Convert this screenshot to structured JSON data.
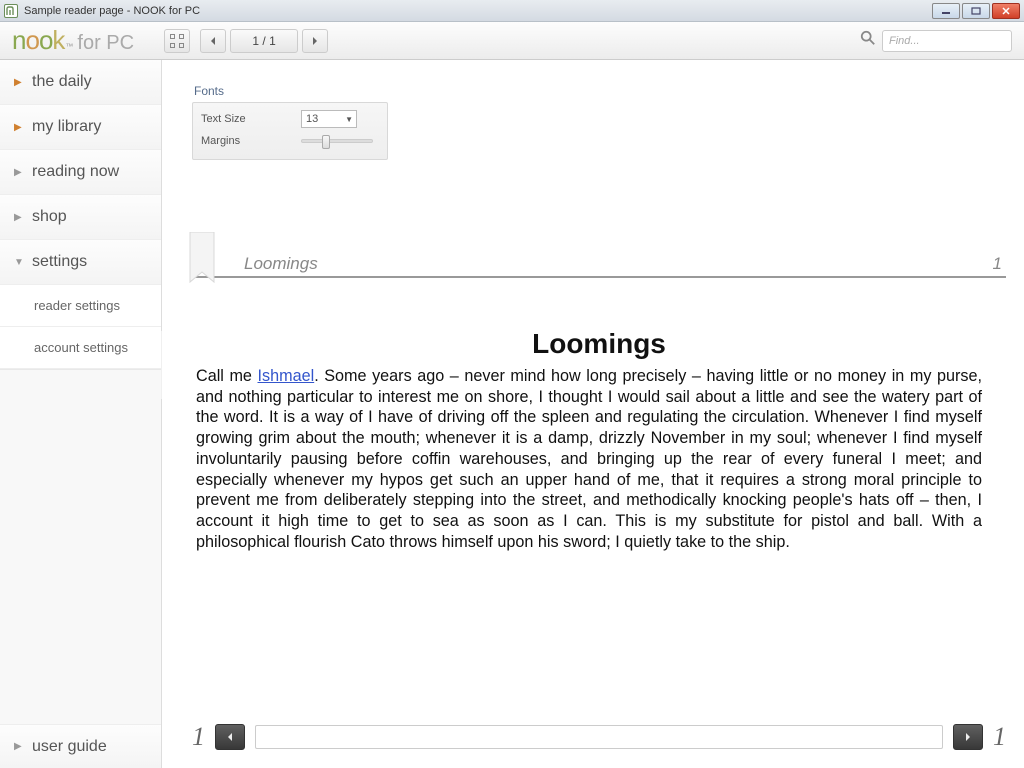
{
  "window": {
    "title": "Sample reader page - NOOK for PC"
  },
  "logo": {
    "sub": "for PC"
  },
  "toolbar": {
    "page_indicator": "1 / 1"
  },
  "search": {
    "placeholder": "Find..."
  },
  "sidebar": {
    "items": [
      {
        "label": "the daily"
      },
      {
        "label": "my library"
      },
      {
        "label": "reading now"
      },
      {
        "label": "shop"
      },
      {
        "label": "settings"
      }
    ],
    "subitems": [
      {
        "label": "reader settings"
      },
      {
        "label": "account settings"
      }
    ],
    "bottom": {
      "label": "user guide"
    }
  },
  "fonts": {
    "title": "Fonts",
    "text_size_label": "Text Size",
    "text_size_value": "13",
    "margins_label": "Margins"
  },
  "header": {
    "chapter": "Loomings",
    "page": "1"
  },
  "chapter": {
    "title": "Loomings",
    "lead": "Call me ",
    "link": "Ishmael",
    "rest": ". Some years ago – never mind how long precisely – having little or no money in my purse, and nothing particular to interest me on shore, I thought I would sail about a little and see the watery part of the word. It is a way of I have of driving off the spleen and regulating the circulation. Whenever I find myself growing grim about the mouth; whenever it is a damp, drizzly November in my soul; whenever I find myself involuntarily pausing before coffin warehouses, and bringing up the rear of every funeral I meet; and especially whenever my hypos get such an upper hand of me, that it requires a strong moral principle to prevent me from deliberately stepping into the street, and methodically knocking people's hats off – then, I account it high time to get to sea as soon as I can. This is my substitute for pistol and ball. With a philosophical flourish Cato throws himself upon his sword; I quietly take to the ship."
  },
  "bottom_nav": {
    "left": "1",
    "right": "1"
  }
}
